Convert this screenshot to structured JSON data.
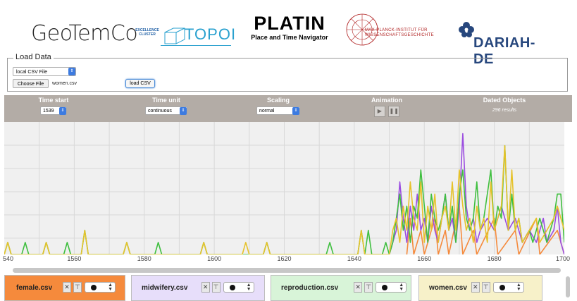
{
  "logos": {
    "geotemco": "GeoTemCo",
    "topoi_sub": "EXCELLENCE CLUSTER",
    "topoi": "TOPOI",
    "platin_title": "PLATIN",
    "platin_sub": "Place and Time Navigator",
    "mpi": "MAX-PLANCK-INSTITUT FÜR WISSENSCHAFTSGESCHICHTE",
    "dariah": "DARIAH-DE"
  },
  "load_data": {
    "legend": "Load Data",
    "source_select": "local CSV File",
    "choose_button": "Choose File",
    "file_name": "women.csv",
    "load_button": "load CSV"
  },
  "controls": {
    "time_start_label": "Time start",
    "time_start_value": "1539",
    "time_unit_label": "Time unit",
    "time_unit_value": "continuous",
    "scaling_label": "Scaling",
    "scaling_value": "normal",
    "animation_label": "Animation",
    "play_icon": "▶",
    "pause_icon": "❚❚",
    "dated_label": "Dated Objects",
    "dated_results": "296 results"
  },
  "datasets": [
    {
      "name": "female.csv",
      "color": "#f58a3c",
      "bg": "#f58a3c"
    },
    {
      "name": "midwifery.csv",
      "color": "#9b4de0",
      "bg": "#e7defa"
    },
    {
      "name": "reproduction.csv",
      "color": "#3fbf3f",
      "bg": "#d8f4d8"
    },
    {
      "name": "women.csv",
      "color": "#e6c22a",
      "bg": "#f7f1c9"
    }
  ],
  "dataset_buttons": {
    "remove": "✕",
    "filter": "⊤"
  },
  "chart_data": {
    "type": "line",
    "x_ticks": [
      "540",
      "1560",
      "1580",
      "1600",
      "1620",
      "1640",
      "1660",
      "1680",
      "1700"
    ],
    "xlim": [
      1540,
      1700
    ],
    "grid": true,
    "series": [
      {
        "name": "female.csv",
        "color": "#f58a3c",
        "points": [
          [
            1655,
            0
          ],
          [
            1656,
            3
          ],
          [
            1657,
            0
          ],
          [
            1659,
            2
          ],
          [
            1660,
            0
          ],
          [
            1663,
            3
          ],
          [
            1664,
            0
          ],
          [
            1666,
            2
          ],
          [
            1667,
            0
          ],
          [
            1670,
            4
          ],
          [
            1671,
            0
          ],
          [
            1674,
            2
          ],
          [
            1675,
            0
          ],
          [
            1680,
            3
          ],
          [
            1681,
            0
          ],
          [
            1686,
            2
          ],
          [
            1687,
            0
          ],
          [
            1692,
            3
          ],
          [
            1693,
            0
          ],
          [
            1698,
            2
          ],
          [
            1700,
            0
          ]
        ]
      },
      {
        "name": "midwifery.csv",
        "color": "#9b4de0",
        "points": [
          [
            1650,
            0
          ],
          [
            1652,
            2
          ],
          [
            1653,
            6
          ],
          [
            1654,
            3
          ],
          [
            1655,
            1
          ],
          [
            1656,
            4
          ],
          [
            1657,
            2
          ],
          [
            1658,
            5
          ],
          [
            1659,
            2
          ],
          [
            1660,
            3
          ],
          [
            1661,
            1
          ],
          [
            1662,
            4
          ],
          [
            1663,
            2
          ],
          [
            1664,
            1
          ],
          [
            1665,
            3
          ],
          [
            1666,
            5
          ],
          [
            1667,
            2
          ],
          [
            1668,
            3
          ],
          [
            1669,
            1
          ],
          [
            1670,
            4
          ],
          [
            1671,
            10
          ],
          [
            1672,
            4
          ],
          [
            1673,
            2
          ],
          [
            1674,
            3
          ],
          [
            1675,
            1
          ],
          [
            1676,
            2
          ],
          [
            1678,
            3
          ],
          [
            1680,
            2
          ],
          [
            1682,
            4
          ],
          [
            1684,
            2
          ],
          [
            1686,
            3
          ],
          [
            1688,
            1
          ],
          [
            1690,
            2
          ],
          [
            1692,
            1
          ],
          [
            1694,
            3
          ],
          [
            1695,
            1
          ],
          [
            1697,
            2
          ],
          [
            1698,
            4
          ],
          [
            1699,
            1
          ],
          [
            1700,
            0
          ]
        ]
      },
      {
        "name": "reproduction.csv",
        "color": "#3fbf3f",
        "points": [
          [
            1540,
            0
          ],
          [
            1541,
            1
          ],
          [
            1542,
            0
          ],
          [
            1545,
            0
          ],
          [
            1546,
            1
          ],
          [
            1547,
            0
          ],
          [
            1551,
            0
          ],
          [
            1552,
            1
          ],
          [
            1553,
            0
          ],
          [
            1557,
            0
          ],
          [
            1558,
            1
          ],
          [
            1559,
            0
          ],
          [
            1562,
            0
          ],
          [
            1563,
            2
          ],
          [
            1564,
            0
          ],
          [
            1574,
            0
          ],
          [
            1575,
            1
          ],
          [
            1576,
            0
          ],
          [
            1583,
            0
          ],
          [
            1584,
            1
          ],
          [
            1585,
            0
          ],
          [
            1596,
            0
          ],
          [
            1597,
            1
          ],
          [
            1598,
            0
          ],
          [
            1614,
            0
          ],
          [
            1615,
            1
          ],
          [
            1616,
            0
          ],
          [
            1632,
            0
          ],
          [
            1633,
            1
          ],
          [
            1634,
            0
          ],
          [
            1641,
            0
          ],
          [
            1642,
            2
          ],
          [
            1643,
            0
          ],
          [
            1644,
            2
          ],
          [
            1645,
            0
          ],
          [
            1648,
            0
          ],
          [
            1649,
            1
          ],
          [
            1650,
            0
          ],
          [
            1651,
            1
          ],
          [
            1652,
            3
          ],
          [
            1653,
            5
          ],
          [
            1654,
            2
          ],
          [
            1655,
            4
          ],
          [
            1656,
            1
          ],
          [
            1657,
            4
          ],
          [
            1658,
            3
          ],
          [
            1659,
            7
          ],
          [
            1660,
            4
          ],
          [
            1661,
            1
          ],
          [
            1662,
            5
          ],
          [
            1663,
            3
          ],
          [
            1664,
            2
          ],
          [
            1665,
            3
          ],
          [
            1666,
            5
          ],
          [
            1667,
            2
          ],
          [
            1668,
            4
          ],
          [
            1669,
            1
          ],
          [
            1670,
            5
          ],
          [
            1671,
            7
          ],
          [
            1672,
            3
          ],
          [
            1673,
            2
          ],
          [
            1674,
            3
          ],
          [
            1675,
            6
          ],
          [
            1676,
            2
          ],
          [
            1677,
            3
          ],
          [
            1678,
            5
          ],
          [
            1679,
            7
          ],
          [
            1680,
            2
          ],
          [
            1681,
            4
          ],
          [
            1682,
            3
          ],
          [
            1683,
            9
          ],
          [
            1684,
            2
          ],
          [
            1685,
            5
          ],
          [
            1686,
            2
          ],
          [
            1687,
            3
          ],
          [
            1688,
            1
          ],
          [
            1690,
            2
          ],
          [
            1691,
            1
          ],
          [
            1693,
            3
          ],
          [
            1694,
            2
          ],
          [
            1695,
            1
          ],
          [
            1696,
            2
          ],
          [
            1697,
            3
          ],
          [
            1698,
            5
          ],
          [
            1699,
            5
          ],
          [
            1700,
            1
          ]
        ]
      },
      {
        "name": "women.csv",
        "color": "#e6c22a",
        "points": [
          [
            1540,
            0
          ],
          [
            1541,
            1
          ],
          [
            1542,
            0
          ],
          [
            1551,
            0
          ],
          [
            1552,
            1
          ],
          [
            1553,
            0
          ],
          [
            1562,
            0
          ],
          [
            1563,
            2
          ],
          [
            1564,
            0
          ],
          [
            1574,
            0
          ],
          [
            1575,
            1
          ],
          [
            1576,
            0
          ],
          [
            1596,
            0
          ],
          [
            1597,
            1
          ],
          [
            1598,
            0
          ],
          [
            1608,
            0
          ],
          [
            1609,
            1
          ],
          [
            1610,
            0
          ],
          [
            1614,
            0
          ],
          [
            1615,
            1
          ],
          [
            1616,
            0
          ],
          [
            1641,
            0
          ],
          [
            1642,
            2
          ],
          [
            1643,
            0
          ],
          [
            1650,
            0
          ],
          [
            1651,
            2
          ],
          [
            1652,
            3
          ],
          [
            1653,
            1
          ],
          [
            1654,
            4
          ],
          [
            1655,
            2
          ],
          [
            1656,
            6
          ],
          [
            1657,
            3
          ],
          [
            1658,
            2
          ],
          [
            1659,
            6
          ],
          [
            1660,
            1
          ],
          [
            1661,
            4
          ],
          [
            1662,
            2
          ],
          [
            1663,
            5
          ],
          [
            1664,
            1
          ],
          [
            1665,
            3
          ],
          [
            1666,
            4
          ],
          [
            1667,
            2
          ],
          [
            1668,
            6
          ],
          [
            1669,
            2
          ],
          [
            1670,
            7
          ],
          [
            1671,
            4
          ],
          [
            1672,
            2
          ],
          [
            1673,
            3
          ],
          [
            1674,
            1
          ],
          [
            1675,
            4
          ],
          [
            1676,
            2
          ],
          [
            1677,
            3
          ],
          [
            1678,
            1
          ],
          [
            1679,
            6
          ],
          [
            1680,
            2
          ],
          [
            1681,
            3
          ],
          [
            1682,
            4
          ],
          [
            1683,
            9
          ],
          [
            1684,
            2
          ],
          [
            1685,
            7
          ],
          [
            1686,
            2
          ],
          [
            1687,
            3
          ],
          [
            1688,
            1
          ],
          [
            1690,
            2
          ],
          [
            1692,
            3
          ],
          [
            1693,
            1
          ],
          [
            1695,
            2
          ],
          [
            1697,
            3
          ],
          [
            1698,
            4
          ],
          [
            1700,
            2
          ]
        ]
      }
    ]
  }
}
